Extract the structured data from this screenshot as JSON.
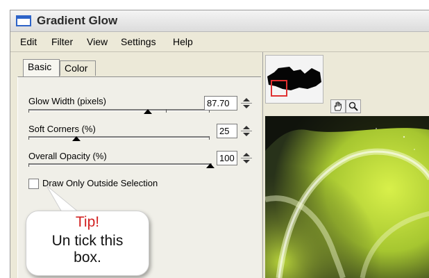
{
  "window": {
    "title": "Gradient Glow"
  },
  "menu": {
    "items": [
      "Edit",
      "Filter",
      "View",
      "Settings",
      "Help"
    ]
  },
  "tabs": [
    "Basic",
    "Color"
  ],
  "controls": {
    "glow_width": {
      "label": "Glow Width (pixels)",
      "value": "87.70"
    },
    "soft_corners": {
      "label": "Soft Corners (%)",
      "value": "25"
    },
    "overall_opacity": {
      "label": "Overall Opacity (%)",
      "value": "100"
    },
    "draw_outside": {
      "label": "Draw Only Outside Selection",
      "checked": false
    }
  },
  "callout": {
    "title": "Tip!",
    "line1": "Un tick this",
    "line2": "box."
  },
  "icons": {
    "pan": "hand-icon",
    "zoom": "magnifier-icon"
  },
  "colors": {
    "title_icon": "#2d63c8",
    "callout_title": "#d22020",
    "glow": "#d8f04a",
    "viewport_marker": "#e03030"
  }
}
